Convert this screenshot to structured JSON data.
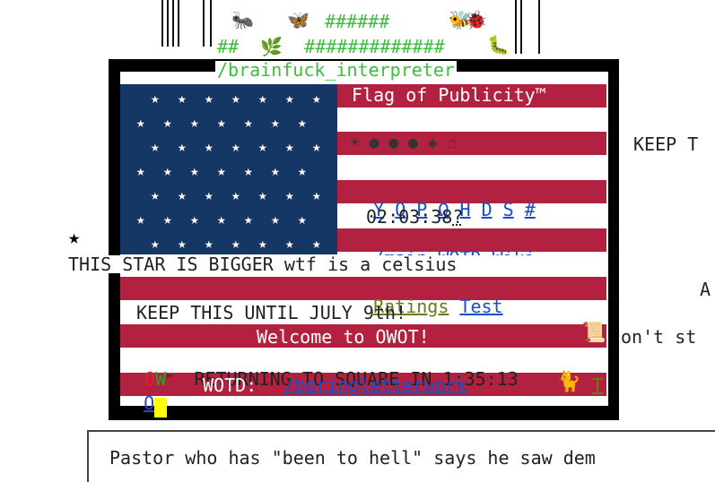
{
  "top_art": {
    "line1": "######",
    "line2": "##  🌿  #############",
    "emoji_ant": "🐜",
    "emoji_butterfly": "🦋",
    "emoji_bee": "🐝",
    "emoji_ladybug": "🐞",
    "emoji_caterpillar": "🐛",
    "path": "/brainfuck_interpreter"
  },
  "flag": {
    "title": "Flag of Publicity™",
    "icons": "☀ ● ● ● ◈ ☝",
    "links_row": [
      "Y",
      "O",
      "P",
      "Ω",
      "H",
      "D",
      "S",
      "#"
    ],
    "clock": "02:03:38",
    "clock_suffix": "?",
    "nav_links": [
      "/main",
      "WOTD",
      "Wiki"
    ],
    "ratings_link": "Ratings",
    "test_link": "Test",
    "keep_line": "KEEP THIS UNTIL JULY 9th!",
    "welcome": "Welcome to OWOT!",
    "scroll_emoji": "📜",
    "owot_o": "O",
    "owot_w": "W",
    "owot_tm": "™",
    "returning": "RETURNING TO SQUARE IN 1:35:13",
    "wotd_o": "O",
    "wotd_label": "WOTD:",
    "wotd_link": "/boringletterwork",
    "cat_emoji": "🐈",
    "wotd_tail": "T"
  },
  "side_text": {
    "keep_right": "KEEP T",
    "star": "★",
    "bigger_line": "THIS STAR IS BIGGER wtf is a celsius",
    "a_right": "A",
    "dont_right": "on't st"
  },
  "news": {
    "line": "Pastor who has \"been to hell\" says he saw dem"
  },
  "colors": {
    "flag_red": "#b22240",
    "flag_blue": "#153766",
    "frame": "#000000",
    "ascii_green": "#3dbd3d",
    "link_blue": "#1a4dcc"
  }
}
